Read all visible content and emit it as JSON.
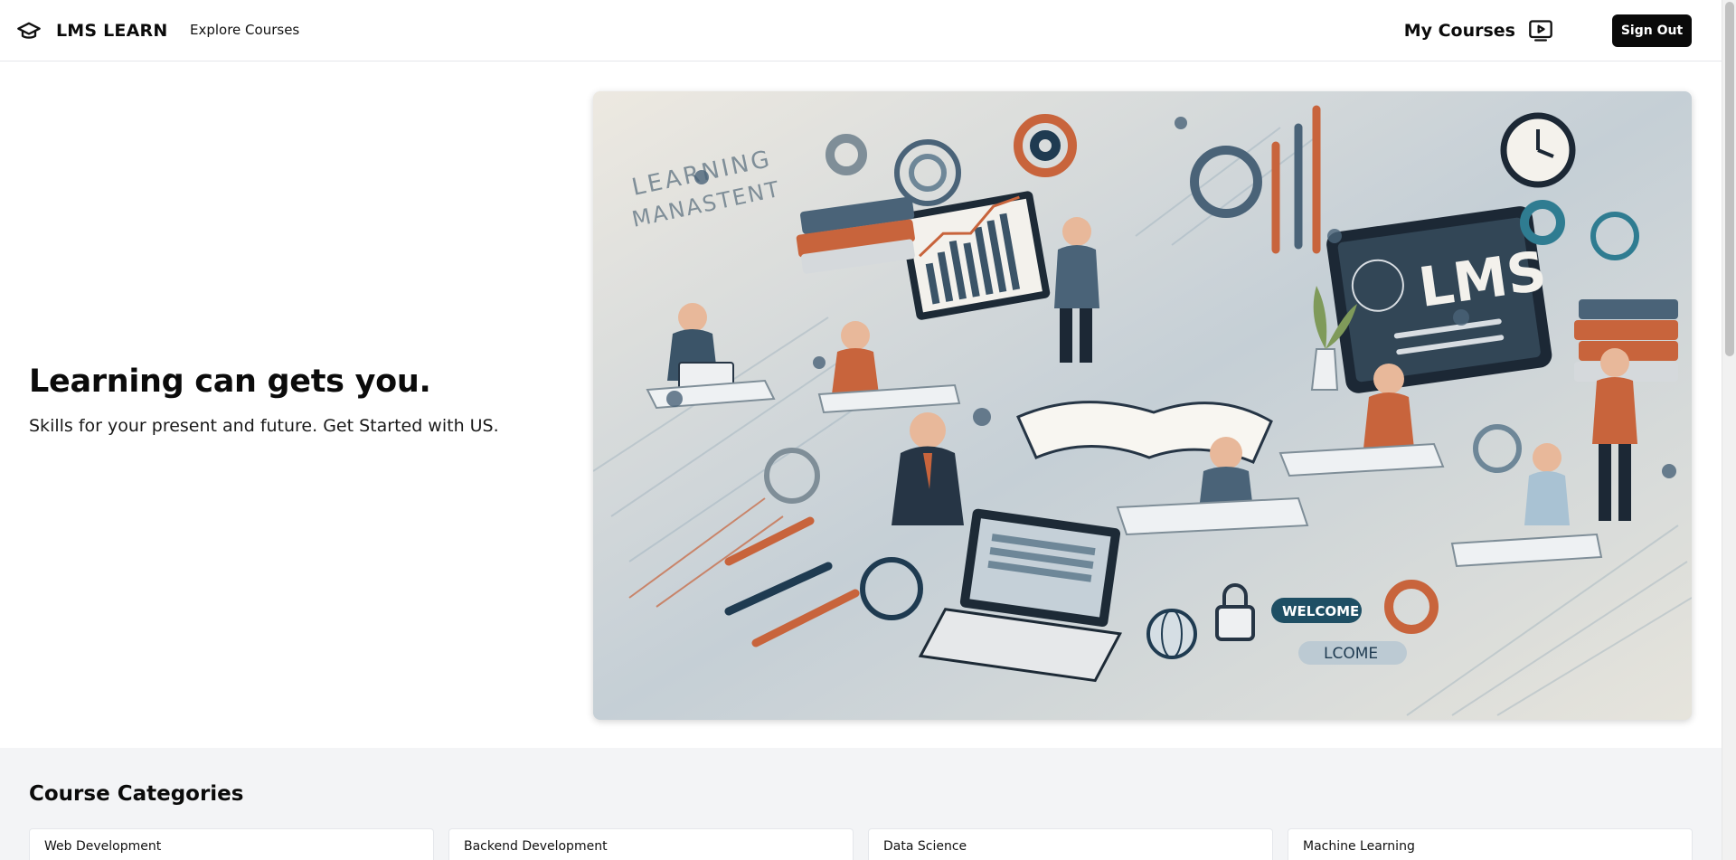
{
  "header": {
    "brand_name": "LMS LEARN",
    "brand_icon": "graduation-cap-icon",
    "nav_explore": "Explore Courses",
    "my_courses_label": "My Courses",
    "my_courses_icon": "tv-play-icon",
    "sign_out_label": "Sign Out"
  },
  "hero": {
    "title": "Learning can gets you.",
    "subtitle": "Skills for your present and future. Get Started with US.",
    "image": {
      "text_learning": "LEARNING",
      "text_manastent": "MANASTENT",
      "text_lms": "LMS",
      "text_welcome": "WELCOME",
      "text_lcome": "LCOME"
    }
  },
  "categories": {
    "title": "Course Categories",
    "items": [
      "Web Development",
      "Backend Development",
      "Data Science",
      "Machine Learning"
    ]
  },
  "colors": {
    "accent_dark": "#0a0a0a",
    "section_bg": "#f3f4f6",
    "image_blue": "#4a6378",
    "image_orange": "#c8643c",
    "image_teal": "#2f7c91"
  }
}
